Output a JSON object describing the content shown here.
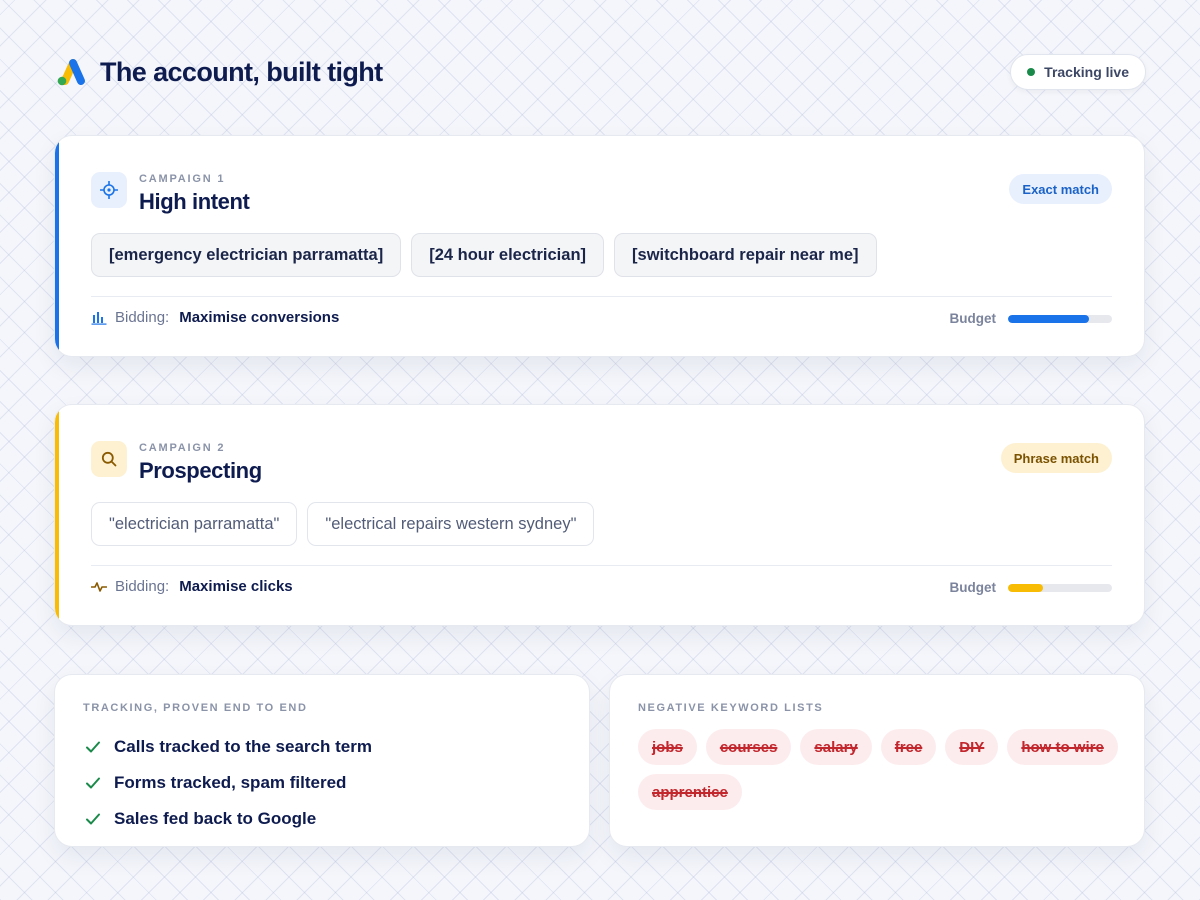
{
  "header": {
    "title": "The account, built tight",
    "status": "Tracking live"
  },
  "colors": {
    "blue": "#1a73e8",
    "yellow": "#f9bc05",
    "green": "#1a8a4a",
    "red": "#c2272d"
  },
  "campaigns": [
    {
      "kicker": "CAMPAIGN 1",
      "name": "High intent",
      "icon": "crosshair-icon",
      "match": "Exact match",
      "keywords": [
        "[emergency electrician parramatta]",
        "[24 hour electrician]",
        "[switchboard repair near me]"
      ],
      "bidding_label": "Bidding:",
      "bidding_icon": "bar-chart-icon",
      "bidding_value": "Maximise conversions",
      "budget_label": "Budget",
      "budget_fraction": 0.78
    },
    {
      "kicker": "CAMPAIGN 2",
      "name": "Prospecting",
      "icon": "search-icon",
      "match": "Phrase match",
      "keywords": [
        "\"electrician parramatta\"",
        "\"electrical repairs western sydney\""
      ],
      "bidding_label": "Bidding:",
      "bidding_icon": "pulse-icon",
      "bidding_value": "Maximise clicks",
      "budget_label": "Budget",
      "budget_fraction": 0.34
    }
  ],
  "tracking": {
    "kicker": "TRACKING, PROVEN END TO END",
    "items": [
      "Calls tracked to the search term",
      "Forms tracked, spam filtered",
      "Sales fed back to Google"
    ]
  },
  "negatives": {
    "kicker": "NEGATIVE KEYWORD LISTS",
    "items": [
      "jobs",
      "courses",
      "salary",
      "free",
      "DIY",
      "how to wire",
      "apprentice"
    ]
  }
}
